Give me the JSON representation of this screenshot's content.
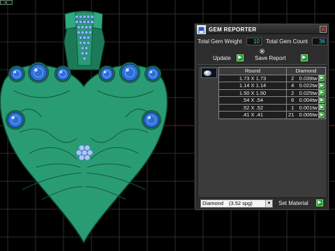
{
  "window": {
    "title": "GEM REPORTER",
    "close_glyph": "✕"
  },
  "totals": {
    "weight_label": "Total Gem Weight",
    "weight_value": "10",
    "count_label": "Total Gem Count",
    "count_value": "36"
  },
  "actions": {
    "update_label": "Update",
    "save_report_label": "Save Report",
    "go_glyph": "▶"
  },
  "table": {
    "headers": [
      "Round",
      "Diamond"
    ],
    "rows": [
      {
        "size": "1.73 X 1.73",
        "count": "2",
        "weight": "0.039tw"
      },
      {
        "size": "1.14 X 1.14",
        "count": "4",
        "weight": "0.022tw"
      },
      {
        "size": "1.50 X 1.50",
        "count": "2",
        "weight": "0.025tw"
      },
      {
        "size": ".54 X .54",
        "count": "6",
        "weight": "0.004tw"
      },
      {
        "size": ".52 X .52",
        "count": "1",
        "weight": "0.001tw"
      },
      {
        "size": ".41 X .41",
        "count": "21",
        "weight": "0.006tw"
      }
    ]
  },
  "material": {
    "selected": "Diamond",
    "spg": "(3.52 spg)",
    "dropdown_glyph": "▼",
    "set_label": "Set Material"
  },
  "colors": {
    "metal": "#2a9c74",
    "metal_dark": "#1c7a58",
    "gem_blue": "#2b6fd6",
    "accent_green": "#1a9b29",
    "value_cyan": "#37d9f2",
    "grid_line": "#2e2e2e",
    "axis_line": "#8c1a1a"
  },
  "icons": {
    "app": "gem-reporter-app-icon",
    "close": "close-icon",
    "go": "play-arrow-icon",
    "thumb": "diamond-thumbnail-icon"
  }
}
